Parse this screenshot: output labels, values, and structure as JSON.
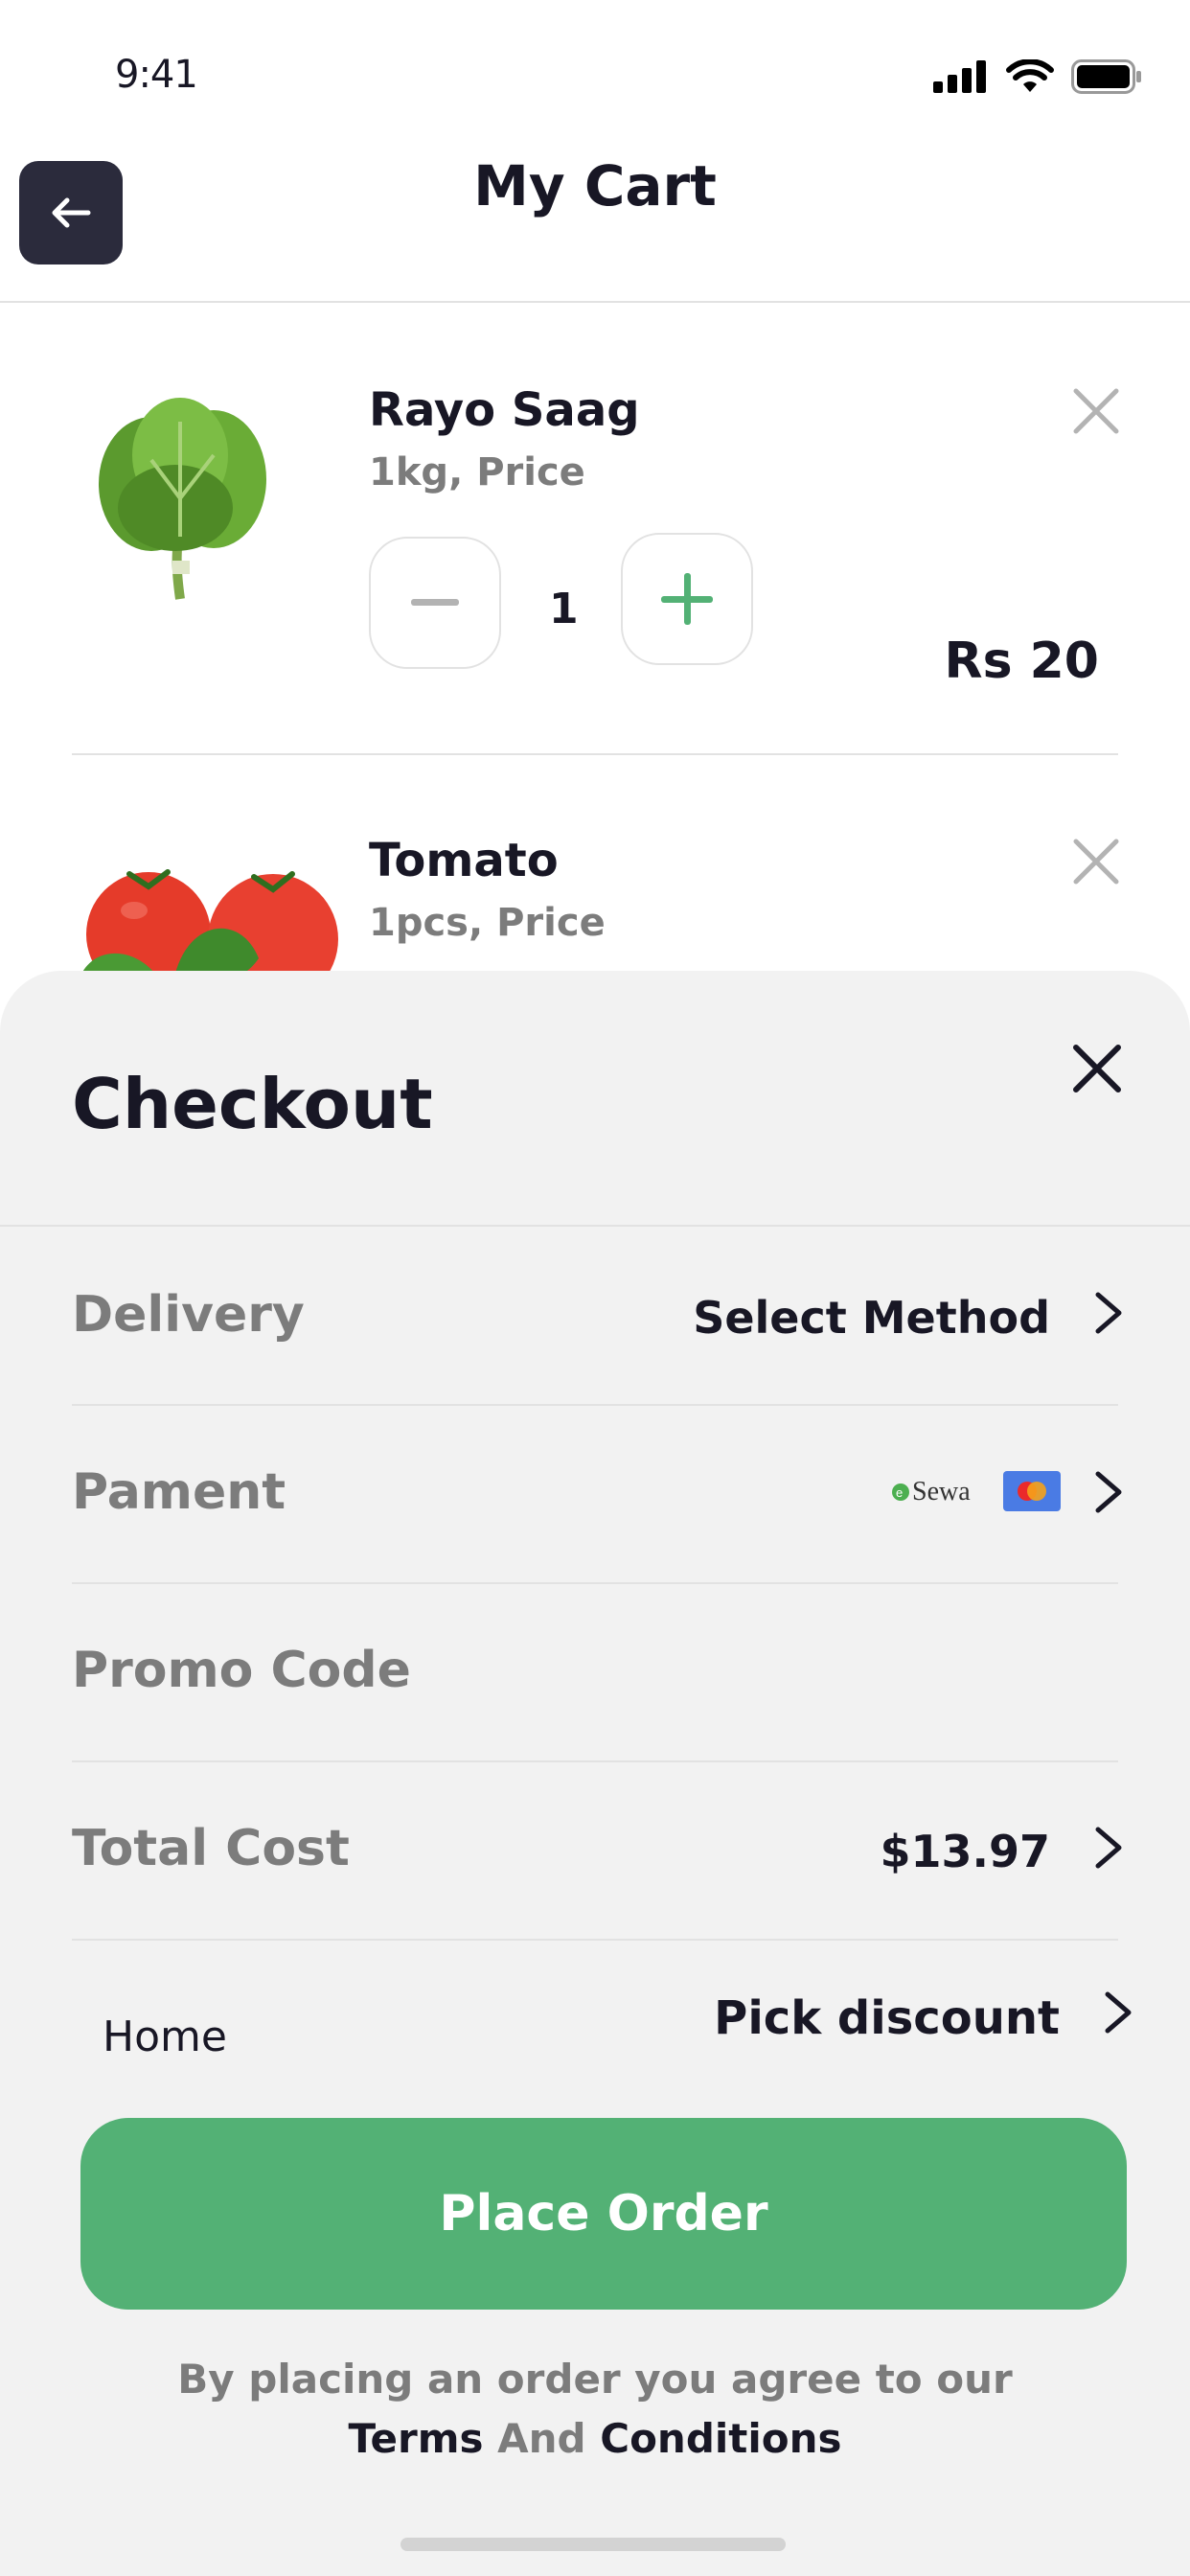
{
  "status_bar": {
    "time": "9:41"
  },
  "header": {
    "title": "My Cart"
  },
  "cart_items": [
    {
      "name": "Rayo Saag",
      "subtitle": "1kg, Price",
      "quantity": "1",
      "price": "Rs 20"
    },
    {
      "name": "Tomato",
      "subtitle": "1pcs, Price"
    }
  ],
  "checkout": {
    "title": "Checkout",
    "delivery_label": "Delivery",
    "delivery_value": "Select Method",
    "payment_label": "Pament",
    "payment_esewa": "Sewa",
    "promo_label": "Promo Code",
    "total_label": "Total Cost",
    "total_value": "$13.97",
    "home_label": "Home",
    "discount_value": "Pick discount",
    "place_order": "Place Order",
    "terms_line1": "By placing an order you agree to our",
    "terms_terms": "Terms",
    "terms_and": "And",
    "terms_conditions": "Conditions"
  },
  "colors": {
    "accent": "#53b175",
    "dark": "#181725",
    "muted": "#7c7c7c",
    "sheet": "#f2f2f2"
  }
}
